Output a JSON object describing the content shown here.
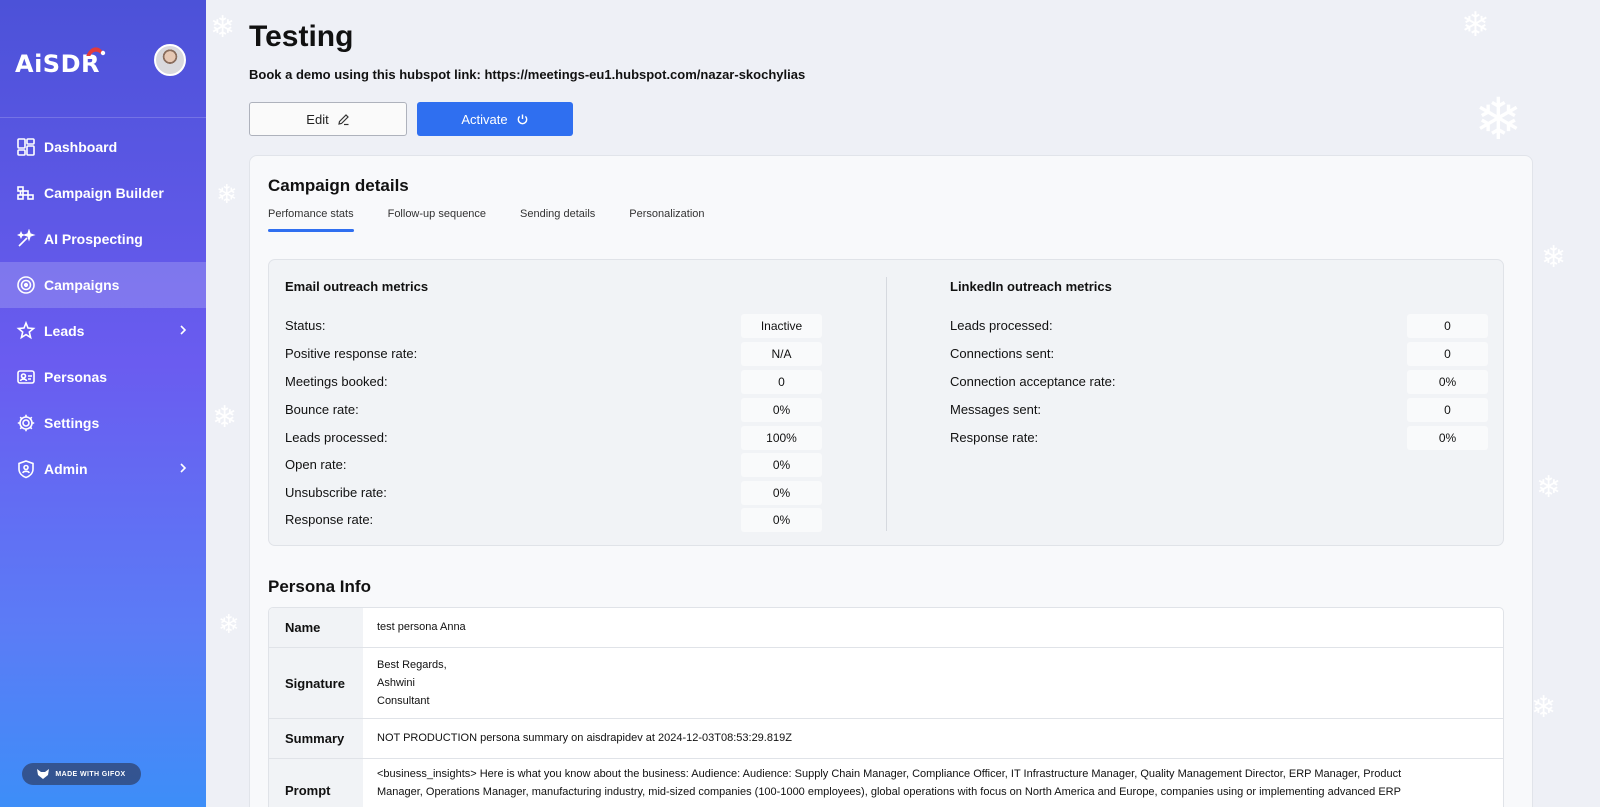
{
  "brand": {
    "logo": "AiSDR",
    "accent": "#2f6ff0"
  },
  "sidebar": {
    "items": [
      {
        "label": "Dashboard",
        "icon": "dashboard-icon"
      },
      {
        "label": "Campaign Builder",
        "icon": "campaign-builder-icon"
      },
      {
        "label": "AI Prospecting",
        "icon": "sparkle-icon"
      },
      {
        "label": "Campaigns",
        "icon": "target-icon",
        "active": true
      },
      {
        "label": "Leads",
        "icon": "star-person-icon"
      },
      {
        "label": "Personas",
        "icon": "persona-card-icon"
      },
      {
        "label": "Settings",
        "icon": "gear-icon"
      },
      {
        "label": "Admin",
        "icon": "shield-user-icon"
      }
    ],
    "gifox_badge": "MADE WITH GIFOX"
  },
  "header": {
    "title": "Testing",
    "subtitle": "Book a demo using this hubspot link: https://meetings-eu1.hubspot.com/nazar-skochylias",
    "edit_label": "Edit",
    "activate_label": "Activate"
  },
  "campaign_details": {
    "title": "Campaign details",
    "tabs": [
      "Perfomance stats",
      "Follow-up sequence",
      "Sending details",
      "Personalization"
    ],
    "active_tab": 0,
    "email": {
      "title": "Email outreach metrics",
      "rows": [
        {
          "label": "Status:",
          "value": "Inactive"
        },
        {
          "label": "Positive response rate:",
          "value": "N/A"
        },
        {
          "label": "Meetings booked:",
          "value": "0"
        },
        {
          "label": "Bounce rate:",
          "value": "0%"
        },
        {
          "label": "Leads processed:",
          "value": "100%"
        },
        {
          "label": "Open rate:",
          "value": "0%"
        },
        {
          "label": "Unsubscribe rate:",
          "value": "0%"
        },
        {
          "label": "Response rate:",
          "value": "0%"
        }
      ]
    },
    "linkedin": {
      "title": "LinkedIn outreach metrics",
      "rows": [
        {
          "label": "Leads processed:",
          "value": "0"
        },
        {
          "label": "Connections sent:",
          "value": "0"
        },
        {
          "label": "Connection acceptance rate:",
          "value": "0%"
        },
        {
          "label": "Messages sent:",
          "value": "0"
        },
        {
          "label": "Response rate:",
          "value": "0%"
        }
      ]
    }
  },
  "persona": {
    "title": "Persona Info",
    "rows": [
      {
        "key": "Name",
        "lines": [
          "test persona Anna"
        ]
      },
      {
        "key": "Signature",
        "lines": [
          "Best Regards,",
          "Ashwini",
          "Consultant"
        ]
      },
      {
        "key": "Summary",
        "lines": [
          "NOT PRODUCTION persona summary on aisdrapidev at 2024-12-03T08:53:29.819Z"
        ]
      },
      {
        "key": "Prompt",
        "lines": [
          "<business_insights> Here is what you know about the business: Audience: Audience: Supply Chain Manager, Compliance Officer, IT Infrastructure Manager, Quality Management Director, ERP Manager, Product",
          "Manager, Operations Manager, manufacturing industry, mid-sized companies (100-1000 employees), global operations with focus on North America and Europe, companies using or implementing advanced ERP"
        ]
      }
    ]
  }
}
